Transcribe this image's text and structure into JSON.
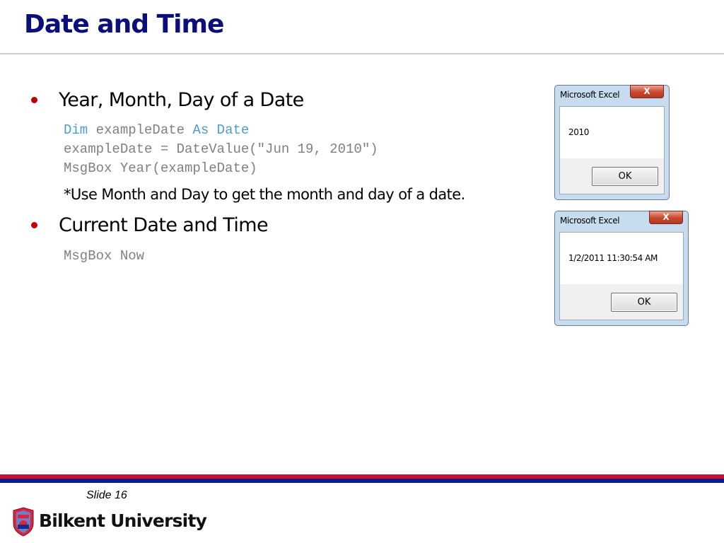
{
  "slide": {
    "title": "Date and Time",
    "bullets": [
      {
        "text": "Year, Month, Day of a Date",
        "code": [
          [
            {
              "t": "Dim",
              "kw": true
            },
            {
              "t": " exampleDate ",
              "kw": false
            },
            {
              "t": "As",
              "kw": true
            },
            {
              "t": " ",
              "kw": false
            },
            {
              "t": "Date",
              "kw": true
            }
          ],
          [
            {
              "t": "exampleDate = DateValue(\"Jun 19, 2010\")",
              "kw": false
            }
          ],
          [
            {
              "t": "MsgBox Year(exampleDate)",
              "kw": false
            }
          ]
        ],
        "note": "*Use Month and Day to get the month and day of a date."
      },
      {
        "text": "Current Date and Time",
        "code": [
          [
            {
              "t": "MsgBox Now",
              "kw": false
            }
          ]
        ]
      }
    ]
  },
  "dialogs": [
    {
      "caption": "Microsoft Excel",
      "message": "2010",
      "ok_label": "OK",
      "close_glyph": "X"
    },
    {
      "caption": "Microsoft Excel",
      "message": "1/2/2011 11:30:54 AM",
      "ok_label": "OK",
      "close_glyph": "X"
    }
  ],
  "footer": {
    "slide_number": "Slide 16",
    "university": "Bilkent University",
    "colors": {
      "red": "#c8102e",
      "blue": "#0b1a8c",
      "title": "#0b0f7a",
      "bullet": "#c00000",
      "keyword": "#4a9fcf"
    }
  }
}
